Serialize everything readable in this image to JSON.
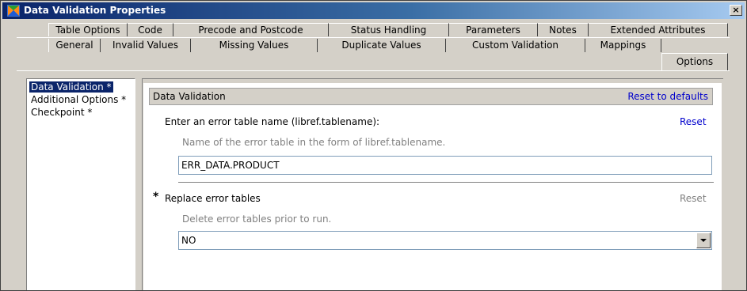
{
  "window": {
    "title": "Data Validation Properties",
    "close_glyph": "×"
  },
  "tabs": {
    "row1": [
      "Table Options",
      "Code",
      "Precode and Postcode",
      "Status Handling",
      "Parameters",
      "Notes",
      "Extended Attributes"
    ],
    "row2": [
      "General",
      "Invalid Values",
      "Missing Values",
      "Duplicate Values",
      "Custom Validation",
      "Mappings",
      "Options"
    ],
    "active": "Options"
  },
  "sidebar": {
    "items": [
      {
        "label": "Data Validation *",
        "selected": true
      },
      {
        "label": "Additional Options *",
        "selected": false
      },
      {
        "label": "Checkpoint *",
        "selected": false
      }
    ]
  },
  "section": {
    "title": "Data Validation",
    "reset_defaults": "Reset to defaults"
  },
  "error_table": {
    "label": "Enter an error table name (libref.tablename):",
    "reset": "Reset",
    "description": "Name of the error table in the form of libref.tablename.",
    "value": "ERR_DATA.PRODUCT"
  },
  "replace_tables": {
    "required_marker": "*",
    "label": "Replace error tables",
    "reset": "Reset",
    "description": "Delete error tables prior to run.",
    "value": "NO"
  },
  "colors": {
    "titlebar": "#0a246a",
    "selection": "#0a246a",
    "link": "#0000cc",
    "dialog_bg": "#d4d0c8"
  }
}
